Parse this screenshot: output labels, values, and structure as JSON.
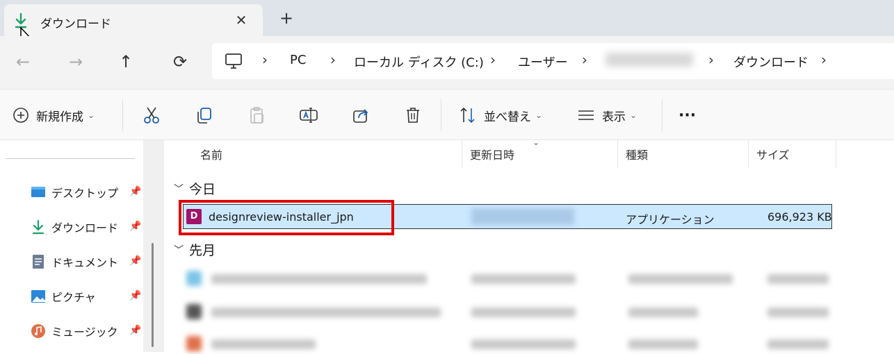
{
  "tab": {
    "title": "ダウンロード",
    "close": "✕",
    "new_tab": "+"
  },
  "nav": {
    "back": "←",
    "forward": "→",
    "up": "↑",
    "refresh": "⟳"
  },
  "breadcrumb": [
    "PC",
    "ローカル ディスク (C:)",
    "ユーザー",
    "",
    "ダウンロード"
  ],
  "toolbar": {
    "new_label": "新規作成",
    "sort_label": "並べ替え",
    "view_label": "表示",
    "more_label": "···"
  },
  "sidebar": {
    "items": [
      {
        "label": "デスクトップ",
        "icon": "desktop-icon"
      },
      {
        "label": "ダウンロード",
        "icon": "download-icon"
      },
      {
        "label": "ドキュメント",
        "icon": "document-icon"
      },
      {
        "label": "ピクチャ",
        "icon": "pictures-icon"
      },
      {
        "label": "ミュージック",
        "icon": "music-icon"
      }
    ]
  },
  "columns": {
    "name": "名前",
    "modified": "更新日時",
    "type": "種類",
    "size": "サイズ"
  },
  "groups": {
    "today": "今日",
    "last_month": "先月"
  },
  "selected_file": {
    "icon_letter": "D",
    "name": "designreview-installer_jpn",
    "type": "アプリケーション",
    "size": "696,923 KB"
  },
  "colors": {
    "accent": "#cce8ff",
    "highlight": "#e00000",
    "app_icon": "#a3136b",
    "download_green": "#1a9e6a"
  }
}
